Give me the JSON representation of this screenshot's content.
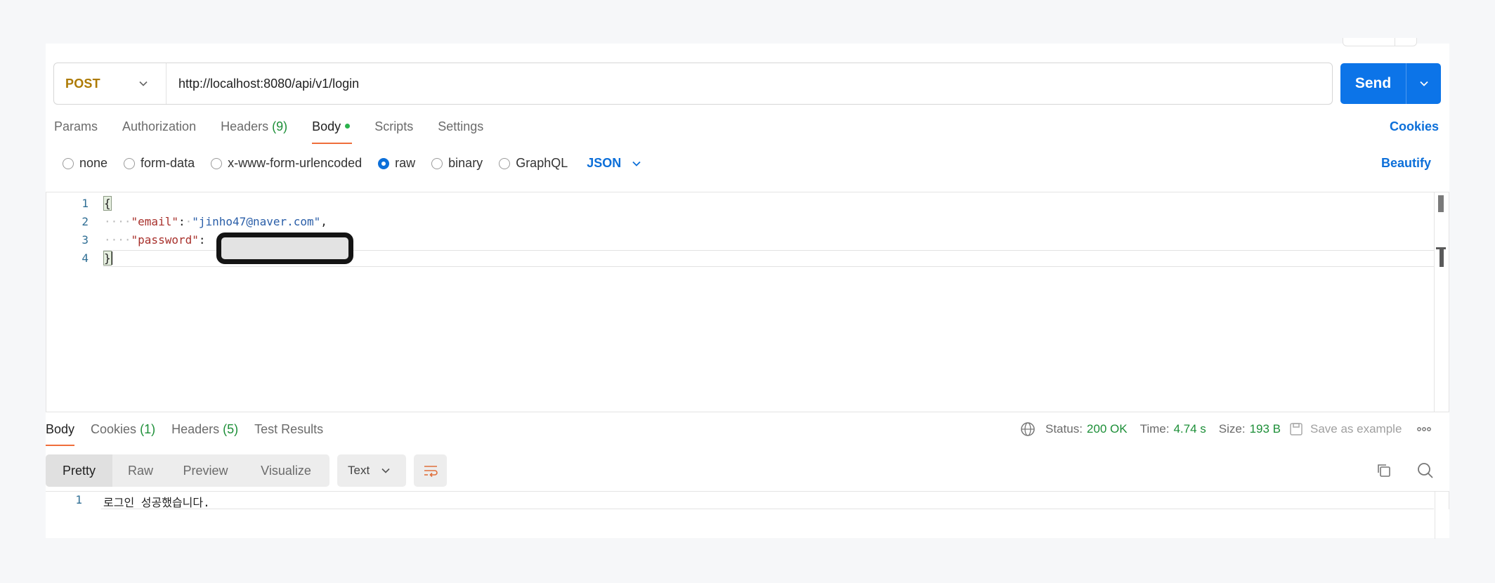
{
  "request": {
    "method": "POST",
    "url": "http://localhost:8080/api/v1/login",
    "send_label": "Send"
  },
  "request_tabs": [
    {
      "label": "Params"
    },
    {
      "label": "Authorization"
    },
    {
      "label": "Headers",
      "count": "(9)"
    },
    {
      "label": "Body"
    },
    {
      "label": "Scripts"
    },
    {
      "label": "Settings"
    }
  ],
  "cookies_link": "Cookies",
  "body_types": [
    {
      "label": "none",
      "selected": false
    },
    {
      "label": "form-data",
      "selected": false
    },
    {
      "label": "x-www-form-urlencoded",
      "selected": false
    },
    {
      "label": "raw",
      "selected": true
    },
    {
      "label": "binary",
      "selected": false
    },
    {
      "label": "GraphQL",
      "selected": false
    }
  ],
  "raw_format": "JSON",
  "beautify_label": "Beautify",
  "editor": {
    "line_numbers": [
      "1",
      "2",
      "3",
      "4"
    ],
    "open_brace": "{",
    "close_brace": "}",
    "indent": "····",
    "email_key": "\"email\"",
    "colon": ":",
    "email_value": "\"jinho47@naver.com\"",
    "comma": ",",
    "password_key": "\"password\""
  },
  "response_tabs": [
    {
      "label": "Body"
    },
    {
      "label": "Cookies",
      "count": "(1)"
    },
    {
      "label": "Headers",
      "count": "(5)"
    },
    {
      "label": "Test Results"
    }
  ],
  "status": {
    "status_label": "Status:",
    "status_value": "200 OK",
    "time_label": "Time:",
    "time_value": "4.74 s",
    "size_label": "Size:",
    "size_value": "193 B",
    "save_example": "Save as example"
  },
  "view_modes": [
    "Pretty",
    "Raw",
    "Preview",
    "Visualize"
  ],
  "response_format": "Text",
  "response_body": {
    "line_number": "1",
    "text": "로그인 성공했습니다."
  },
  "colors": {
    "accent": "#0c74e8",
    "method": "#ad7a03",
    "success": "#1d8f38",
    "active_tab": "#ef6e3b"
  }
}
